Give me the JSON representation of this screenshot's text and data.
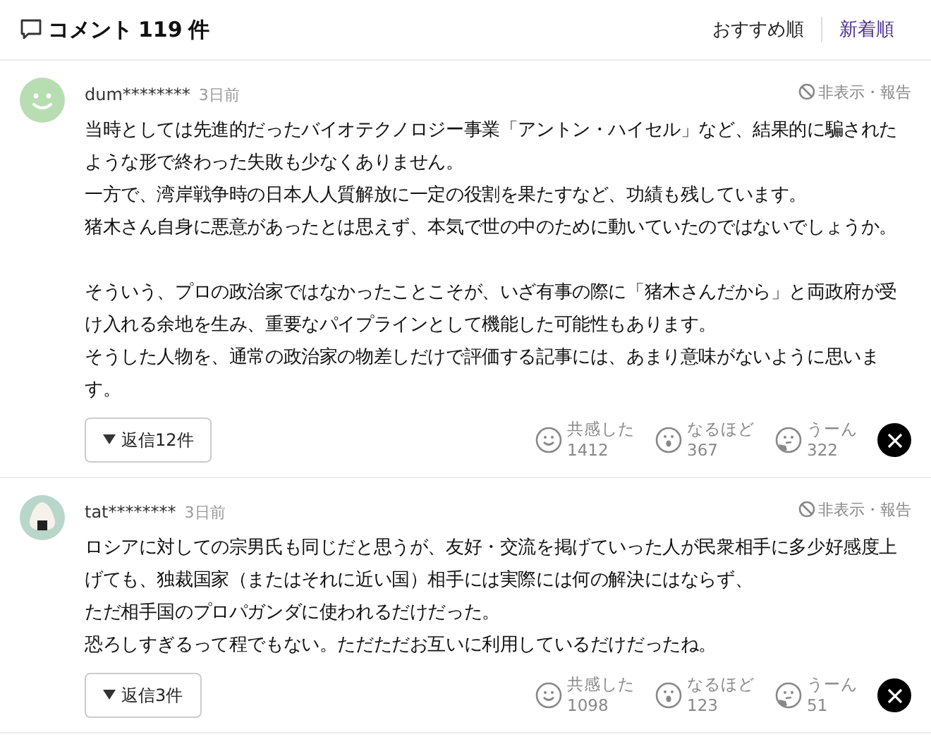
{
  "header": {
    "title": "コメント",
    "count": "119",
    "count_unit": "件",
    "sort_options": [
      {
        "label": "おすすめ順",
        "selected": false
      },
      {
        "label": "新着順",
        "selected": true
      }
    ]
  },
  "comments": [
    {
      "avatar": {
        "kind": "smiley"
      },
      "user": "dum********",
      "time": "3日前",
      "hide_report": "非表示・報告",
      "paragraphs": [
        [
          "当時としては先進的だったバイオテクノロジー事業「アントン・ハイセル」など、結果的に騙されたような形で終わった失敗も少なくありません。",
          "一方で、湾岸戦争時の日本人人質解放に一定の役割を果たすなど、功績も残しています。",
          "猪木さん自身に悪意があったとは思えず、本気で世の中のために動いていたのではないでしょうか。"
        ],
        [
          "そういう、プロの政治家ではなかったことこそが、いざ有事の際に「猪木さんだから」と両政府が受け入れる余地を生み、重要なパイプラインとして機能した可能性もあります。",
          "そうした人物を、通常の政治家の物差しだけで評価する記事には、あまり意味がないように思います。"
        ]
      ],
      "replies": "返信12件",
      "reactions": [
        {
          "kind": "empathy",
          "label": "共感した",
          "count": "1412"
        },
        {
          "kind": "insight",
          "label": "なるほど",
          "count": "367"
        },
        {
          "kind": "doubt",
          "label": "うーん",
          "count": "322"
        }
      ]
    },
    {
      "avatar": {
        "kind": "onigiri"
      },
      "user": "tat********",
      "time": "3日前",
      "hide_report": "非表示・報告",
      "paragraphs": [
        [
          "ロシアに対しての宗男氏も同じだと思うが、友好・交流を掲げていった人が民衆相手に多少好感度上げても、独裁国家（またはそれに近い国）相手には実際には何の解決にはならず、",
          "ただ相手国のプロパガンダに使われるだけだった。",
          "恐ろしすぎるって程でもない。ただただお互いに利用しているだけだったね。"
        ]
      ],
      "replies": "返信3件",
      "reactions": [
        {
          "kind": "empathy",
          "label": "共感した",
          "count": "1098"
        },
        {
          "kind": "insight",
          "label": "なるほど",
          "count": "123"
        },
        {
          "kind": "doubt",
          "label": "うーん",
          "count": "51"
        }
      ]
    }
  ]
}
